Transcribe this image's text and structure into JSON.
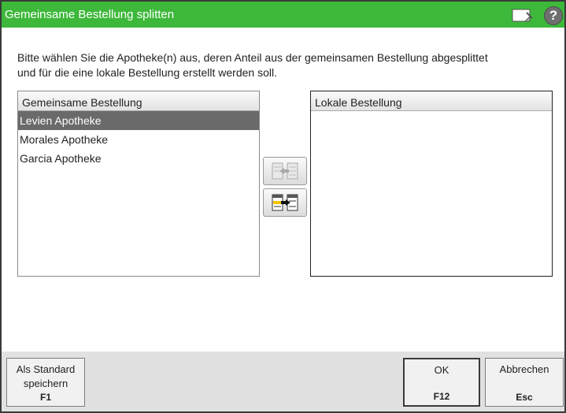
{
  "window": {
    "title": "Gemeinsame Bestellung splitten",
    "title_bar_color": "#3db83a",
    "icons": [
      "note-icon",
      "help-icon"
    ],
    "help_glyph": "?"
  },
  "instruction": {
    "line1": "Bitte wählen Sie die Apotheke(n) aus, deren Anteil aus der gemeinsamen Bestellung abgesplittet",
    "line2": "und für die eine lokale Bestellung erstellt werden soll."
  },
  "left_list": {
    "header": "Gemeinsame Bestellung",
    "items": [
      {
        "label": "Levien Apotheke",
        "selected": true
      },
      {
        "label": "Morales Apotheke",
        "selected": false
      },
      {
        "label": "Garcia Apotheke",
        "selected": false
      }
    ]
  },
  "right_list": {
    "header": "Lokale Bestellung",
    "items": []
  },
  "move_buttons": {
    "move_left_icon": "move-to-left-icon",
    "move_right_icon": "move-to-right-icon",
    "move_left_enabled": false,
    "move_right_enabled": true
  },
  "footer": {
    "standard": {
      "label_line1": "Als Standard",
      "label_line2": "speichern",
      "key": "F1"
    },
    "ok": {
      "label": "OK",
      "key": "F12"
    },
    "cancel": {
      "label": "Abbrechen",
      "key": "Esc"
    }
  }
}
